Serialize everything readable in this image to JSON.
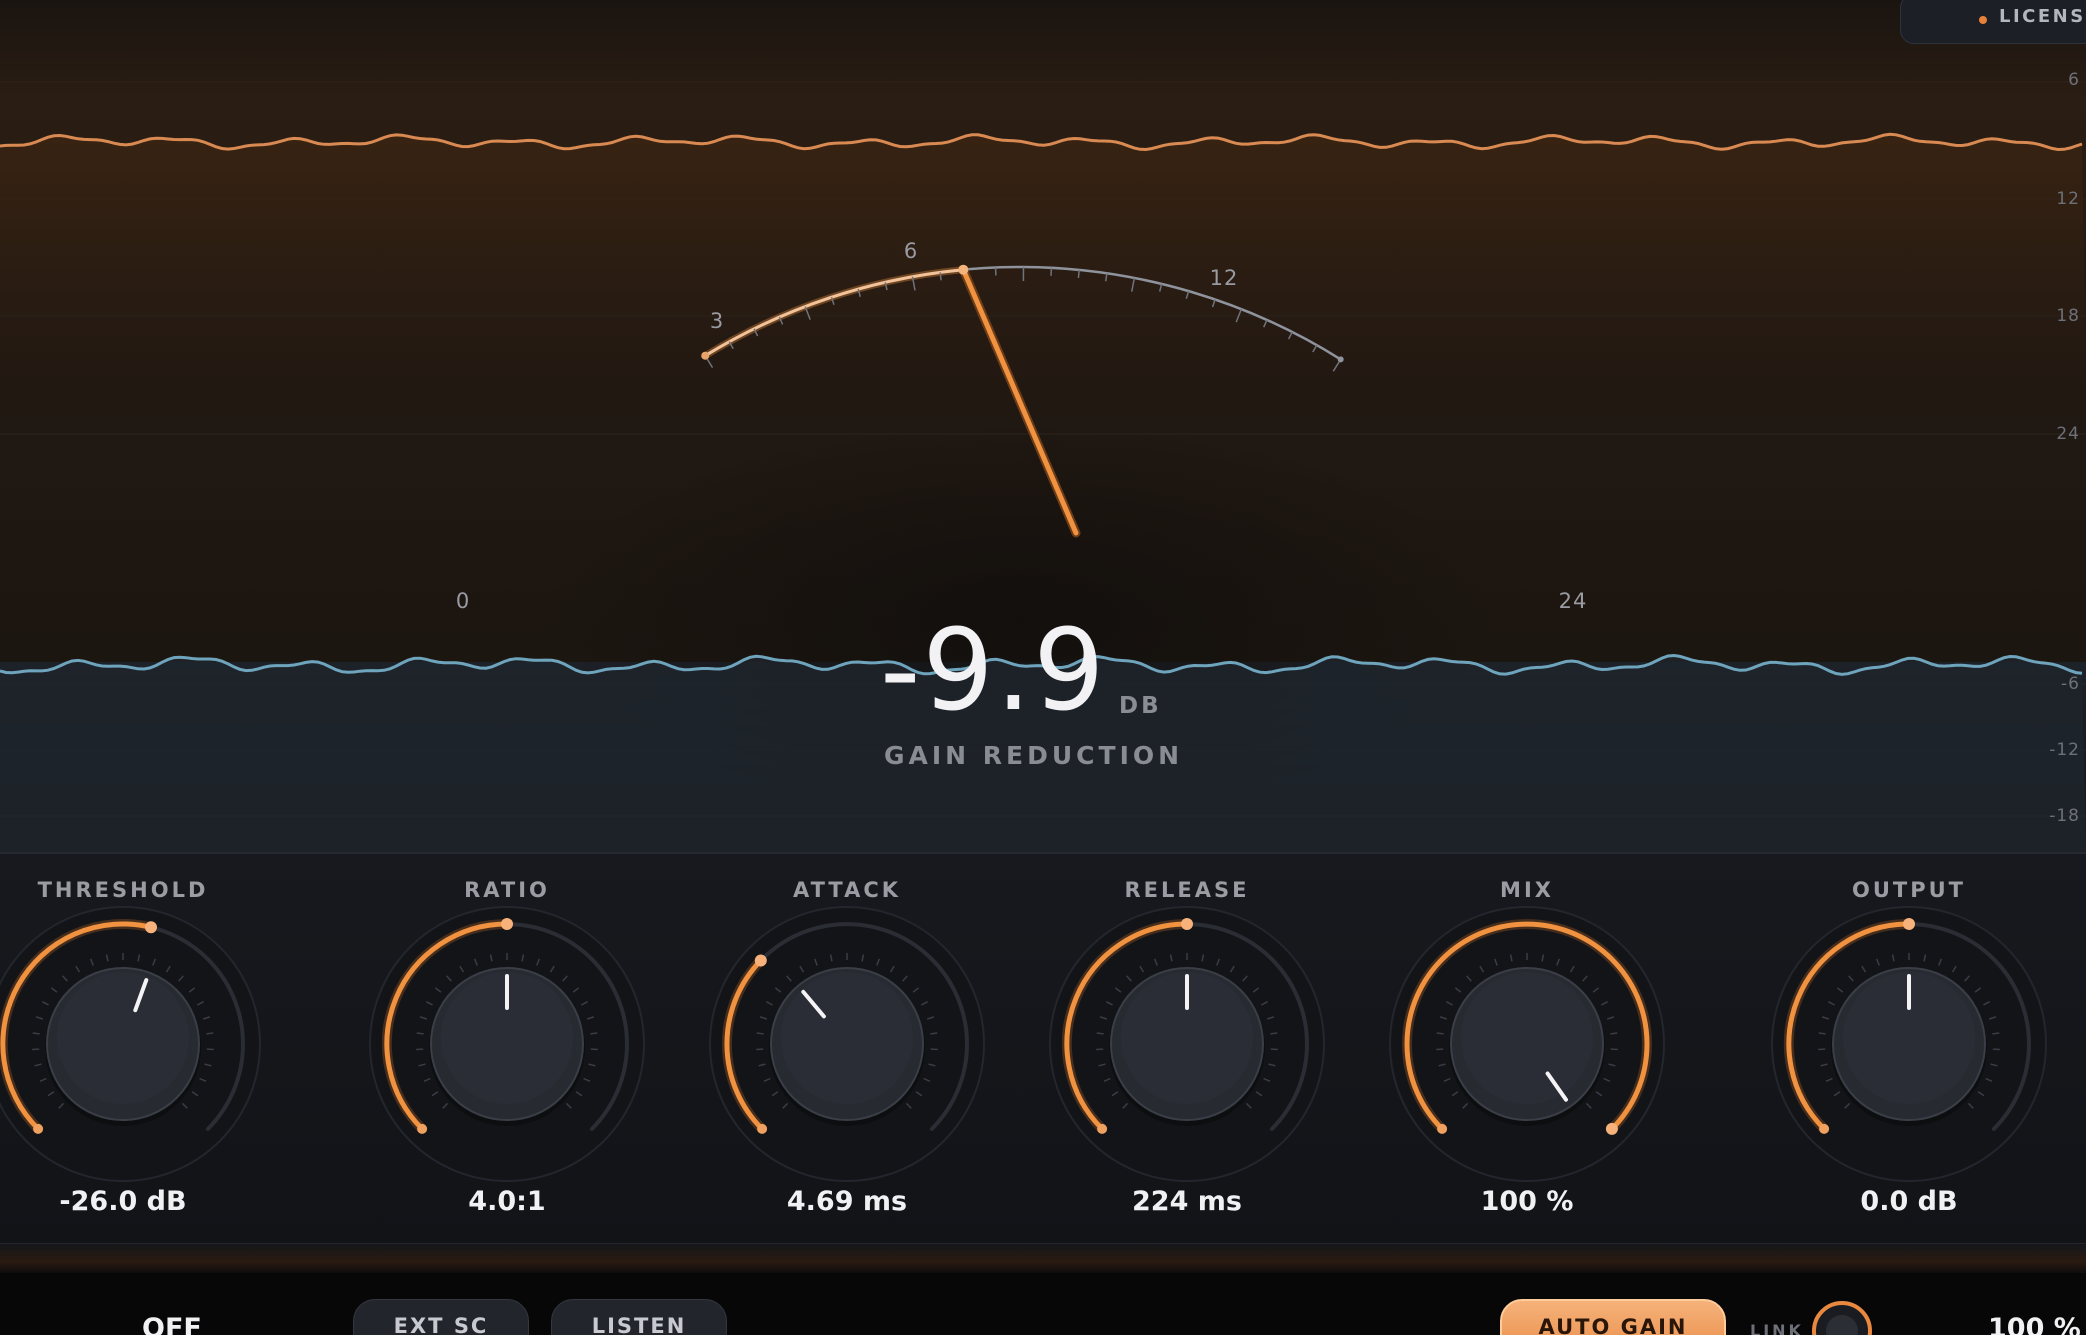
{
  "license": {
    "label": "LICENSED"
  },
  "scope": {
    "right_scale_top": [
      "6",
      "12",
      "18",
      "24"
    ],
    "right_scale_bottom": [
      "-6",
      "-12",
      "-18"
    ]
  },
  "meter": {
    "arc_labels": [
      "0",
      "3",
      "6",
      "12",
      "24"
    ],
    "needle_fraction": 0.41,
    "value": "-9.9",
    "unit": "DB",
    "caption": "GAIN REDUCTION"
  },
  "controls": {
    "knobs": [
      {
        "label": "THRESHOLD",
        "value": "-26.0 dB",
        "fill": 0.55,
        "pointer_deg": 20
      },
      {
        "label": "RATIO",
        "value": "4.0:1",
        "fill": 0.5,
        "pointer_deg": 0
      },
      {
        "label": "ATTACK",
        "value": "4.69 ms",
        "fill": 0.33,
        "pointer_deg": -40
      },
      {
        "label": "RELEASE",
        "value": "224 ms",
        "fill": 0.5,
        "pointer_deg": 0
      },
      {
        "label": "MIX",
        "value": "100 %",
        "fill": 1.0,
        "pointer_deg": 145
      },
      {
        "label": "OUTPUT",
        "value": "0.0 dB",
        "fill": 0.5,
        "pointer_deg": 0
      }
    ]
  },
  "footer": {
    "bypass_state": "OFF",
    "ext_sc_label": "EXT SC",
    "listen_label": "LISTEN",
    "auto_gain_label": "AUTO GAIN",
    "link_label": "LINK",
    "link_value": "100 %"
  },
  "colors": {
    "accent": "#f0923f",
    "input_wave": "#d98a52",
    "output_wave": "#6fa4bd",
    "panel_bg": "#15171b"
  }
}
